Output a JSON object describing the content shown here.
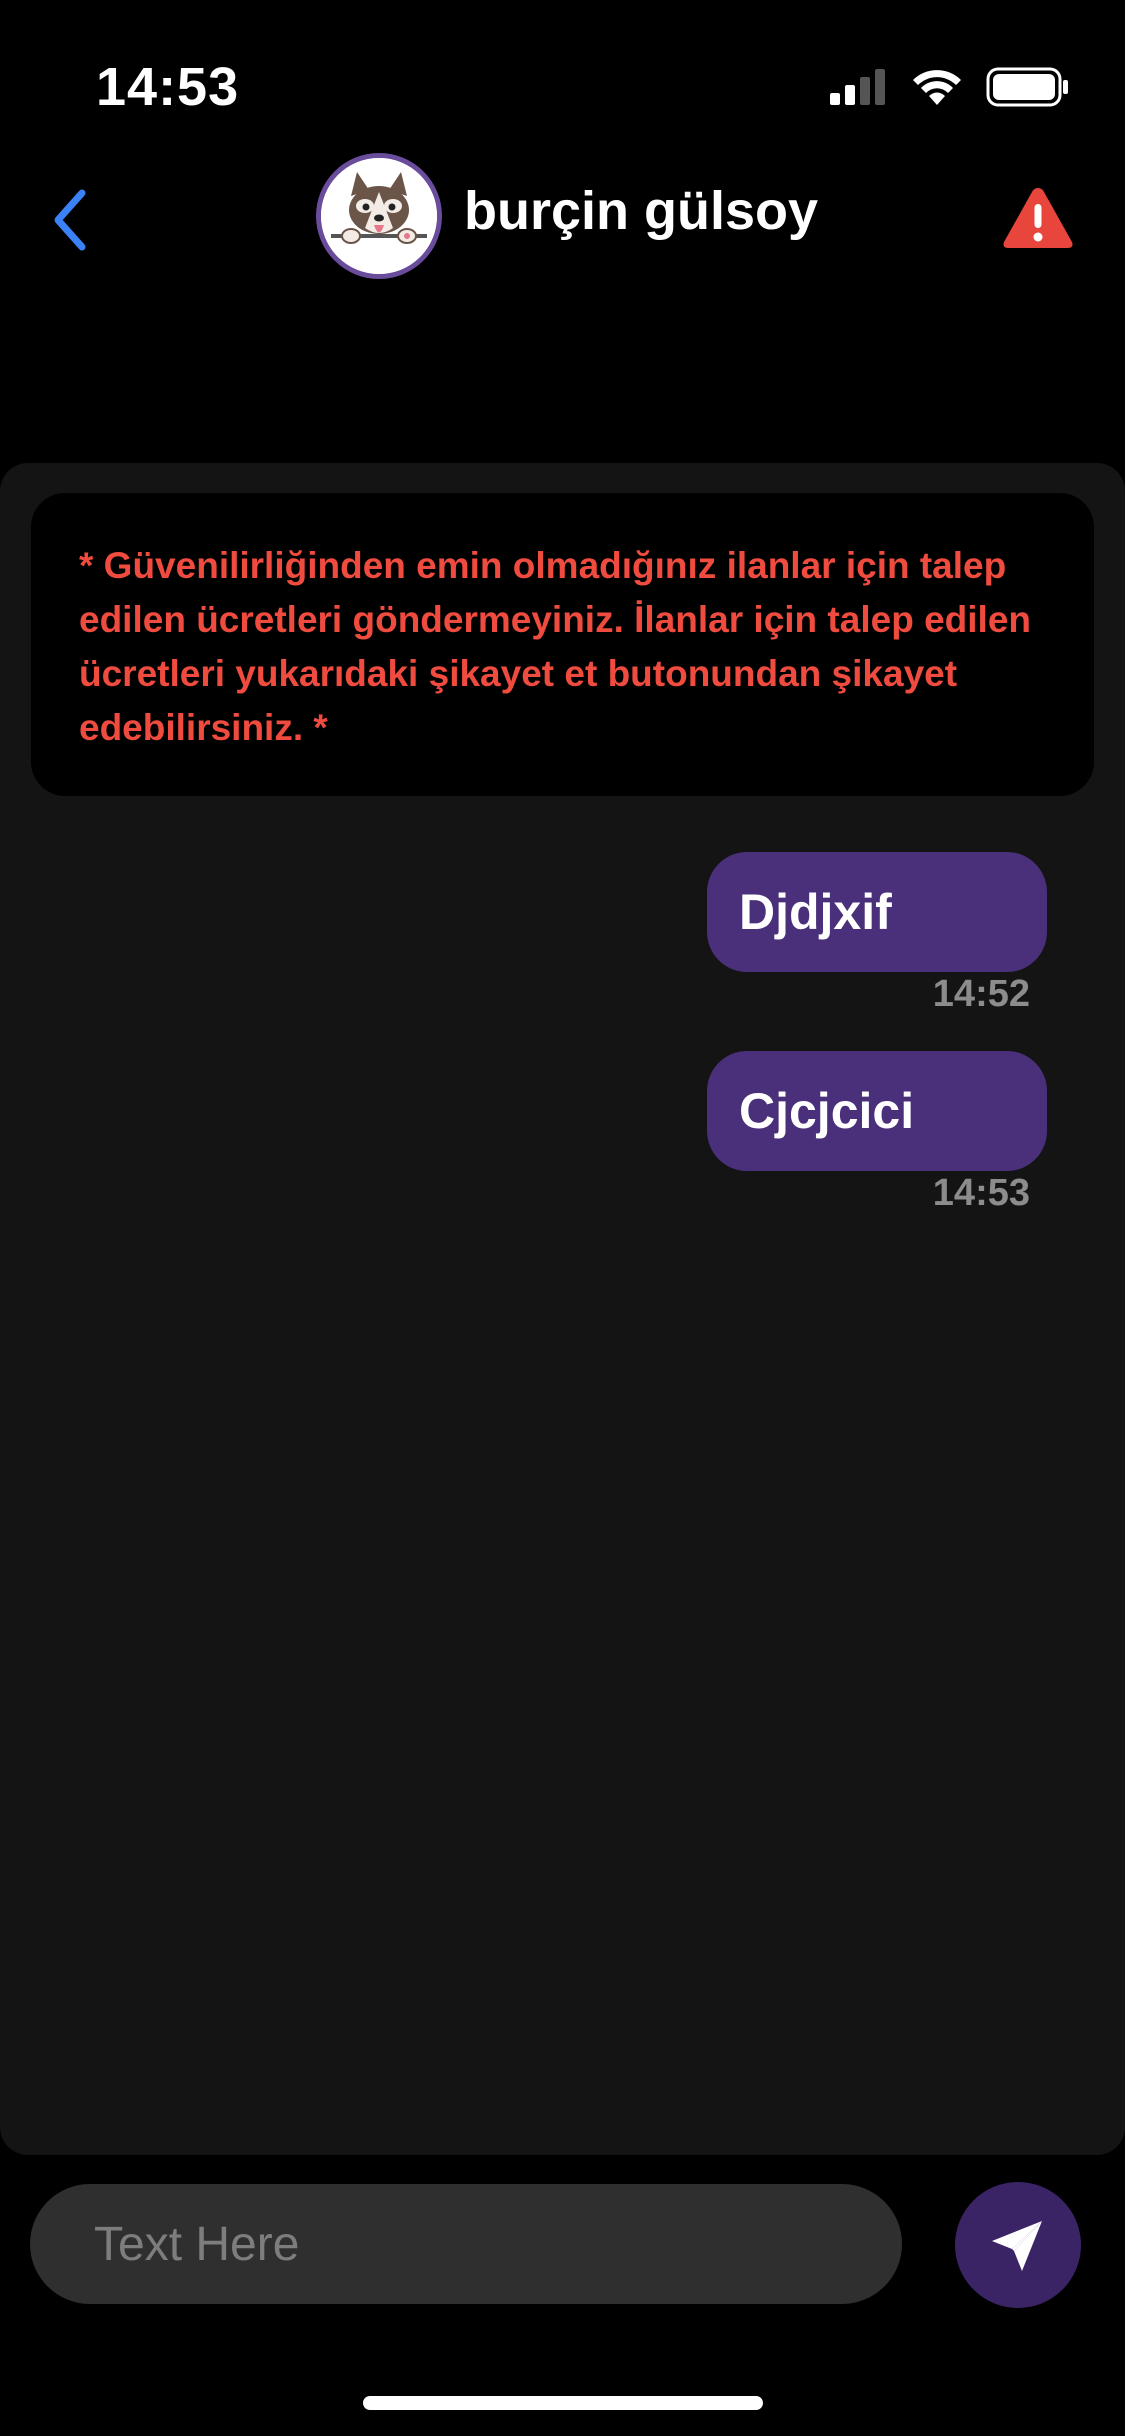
{
  "status_bar": {
    "time": "14:53",
    "icons": [
      "cellular-signal-icon",
      "wifi-icon",
      "battery-icon"
    ]
  },
  "header": {
    "back_icon": "chevron-left-icon",
    "contact_name": "burçin gülsoy",
    "avatar_icon": "husky-dog-avatar",
    "report_icon": "warning-triangle-icon"
  },
  "warning": {
    "text": "* Güvenilirliğinden emin olmadığınız ilanlar için talep edilen ücretleri göndermeyiniz. İlanlar için talep edilen ücretleri yukarıdaki şikayet et butonundan şikayet edebilirsiniz. *"
  },
  "messages": [
    {
      "text": "Djdjxif",
      "time": "14:52"
    },
    {
      "text": "Cjcjcici",
      "time": "14:53"
    }
  ],
  "composer": {
    "placeholder": "Text Here",
    "value": "",
    "send_icon": "paper-plane-icon"
  },
  "colors": {
    "accent_back": "#3b82f6",
    "warning_text": "#ef4b3f",
    "report_icon": "#e8453c",
    "bubble": "#4a2f7a",
    "send_button": "#3a2466"
  }
}
